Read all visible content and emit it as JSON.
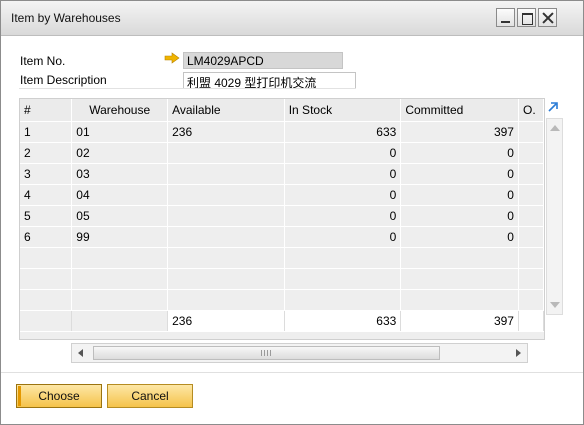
{
  "window": {
    "title": "Item by Warehouses"
  },
  "header": {
    "item_no_label": "Item No.",
    "item_no_value": "LM4029APCD",
    "item_desc_label": "Item Description",
    "item_desc_value": "利盟 4029 型打印机交流"
  },
  "table": {
    "columns": [
      "#",
      "Warehouse",
      "Available",
      "In Stock",
      "Committed",
      "O."
    ],
    "rows": [
      [
        "1",
        "01",
        "236",
        "633",
        "397",
        ""
      ],
      [
        "2",
        "02",
        "",
        "0",
        "0",
        ""
      ],
      [
        "3",
        "03",
        "",
        "0",
        "0",
        ""
      ],
      [
        "4",
        "04",
        "",
        "0",
        "0",
        ""
      ],
      [
        "5",
        "05",
        "",
        "0",
        "0",
        ""
      ],
      [
        "6",
        "99",
        "",
        "0",
        "0",
        ""
      ],
      [
        "",
        "",
        "",
        "",
        "",
        ""
      ],
      [
        "",
        "",
        "",
        "",
        "",
        ""
      ],
      [
        "",
        "",
        "",
        "",
        "",
        ""
      ]
    ],
    "totals": [
      "",
      "",
      "236",
      "633",
      "397",
      ""
    ]
  },
  "buttons": {
    "choose": "Choose",
    "cancel": "Cancel"
  },
  "colors": {
    "button_fill": "#f5c34b",
    "link_arrow": "#f0b400",
    "expand_icon": "#2a7bd6"
  }
}
